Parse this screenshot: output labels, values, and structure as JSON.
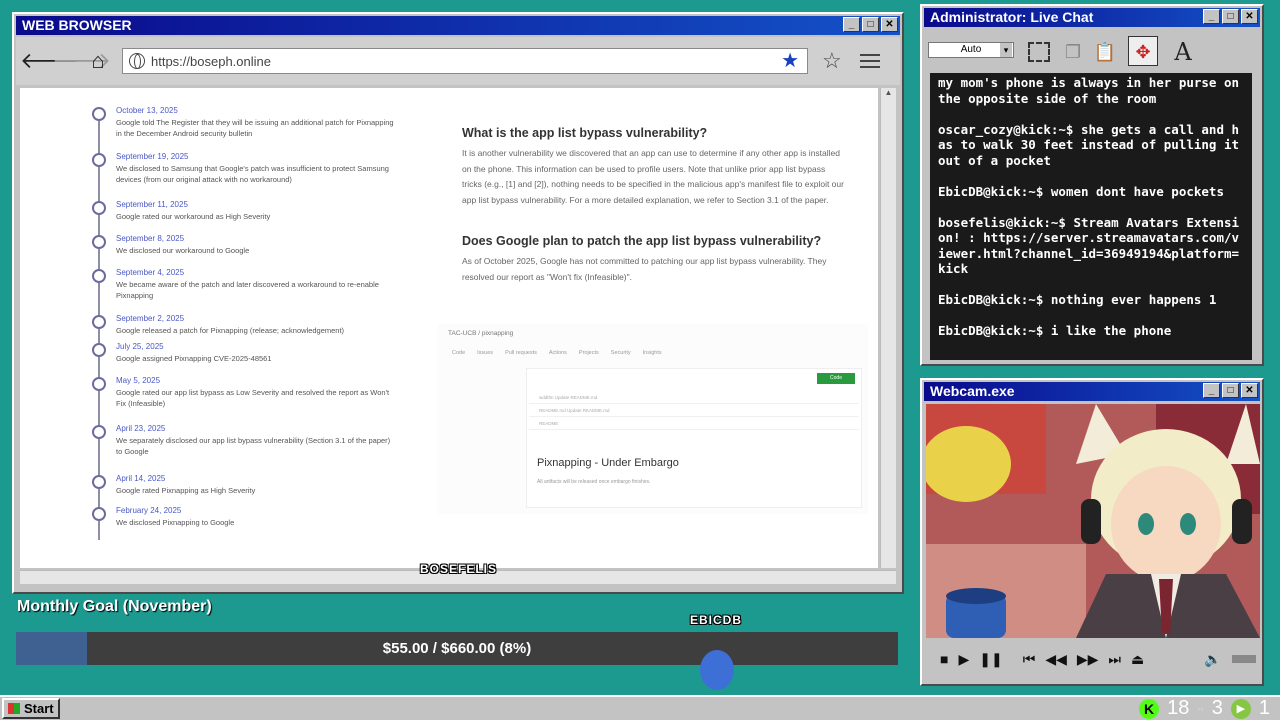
{
  "browser": {
    "title": "WEB BROWSER",
    "url": "https://boseph.online",
    "timeline": [
      {
        "date": "October 13, 2025",
        "desc": "Google told The Register that they will be issuing an additional patch for Pixnapping in the December Android security bulletin"
      },
      {
        "date": "September 19, 2025",
        "desc": "We disclosed to Samsung that Google's patch was insufficient to protect Samsung devices (from our original attack with no workaround)"
      },
      {
        "date": "September 11, 2025",
        "desc": "Google rated our workaround as High Severity"
      },
      {
        "date": "September 8, 2025",
        "desc": "We disclosed our workaround to Google"
      },
      {
        "date": "September 4, 2025",
        "desc": "We became aware of the patch and later discovered a workaround to re-enable Pixnapping"
      },
      {
        "date": "September 2, 2025",
        "desc": "Google released a patch for Pixnapping (release; acknowledgement)"
      },
      {
        "date": "July 25, 2025",
        "desc": "Google assigned Pixnapping CVE-2025-48561"
      },
      {
        "date": "May 5, 2025",
        "desc": "Google rated our app list bypass as Low Severity and resolved the report as Won't Fix (Infeasible)"
      },
      {
        "date": "April 23, 2025",
        "desc": "We separately disclosed our app list bypass vulnerability (Section 3.1 of the paper) to Google"
      },
      {
        "date": "April 14, 2025",
        "desc": "Google rated Pixnapping as High Severity"
      },
      {
        "date": "February 24, 2025",
        "desc": "We disclosed Pixnapping to Google"
      }
    ],
    "q1": "What is the app list bypass vulnerability?",
    "p1": "It is another vulnerability we discovered that an app can use to determine if any other app is installed on the phone. This information can be used to profile users. Note that unlike prior app list bypass tricks (e.g., [1] and [2]), nothing needs to be specified in the malicious app's manifest file to exploit our app list bypass vulnerability. For a more detailed explanation, we refer to Section 3.1 of the paper.",
    "q2": "Does Google plan to patch the app list bypass vulnerability?",
    "p2": "As of October 2025, Google has not committed to patching our app list bypass vulnerability. They resolved our report as \"Won't fix (Infeasible)\".",
    "github": {
      "crumb": "TAC-UCB / pixnapping",
      "tabs": [
        "Code",
        "Issues",
        "Pull requests",
        "Actions",
        "Projects",
        "Security",
        "Insights"
      ],
      "code_btn": "Code",
      "rows": [
        "wddtfm  Update README.md",
        "README.md  Update README.md",
        "README"
      ],
      "repo_title": "Pixnapping - Under Embargo",
      "repo_sub": "All artifacts will be released once embargo finishes."
    }
  },
  "chat": {
    "title": "Administrator: Live Chat",
    "select": "Auto",
    "tool_text_icon": "A",
    "messages": [
      {
        "user": "",
        "text": "my mom's phone is always in her purse on the opposite side of the room"
      },
      {
        "user": "oscar_cozy@kick:~$",
        "text": "she gets a call and has to walk 30 feet instead of pulling it out of a pocket"
      },
      {
        "user": "EbicDB@kick:~$",
        "text": "women dont have pockets"
      },
      {
        "user": "bosefelis@kick:~$",
        "text": "Stream Avatars Extension! : https://server.streamavatars.com/viewer.html?channel_id=36949194&platform=kick"
      },
      {
        "user": "EbicDB@kick:~$",
        "text": "nothing ever happens 1"
      },
      {
        "user": "EbicDB@kick:~$",
        "text": "i like the phone"
      }
    ]
  },
  "cam": {
    "title": "Webcam.exe"
  },
  "goal": {
    "title": "Monthly Goal (November)",
    "text": "$55.00 / $660.00 (8%)",
    "fraction": 0.08
  },
  "avatars": {
    "a1": "BOSEFELIS",
    "a2": "EBICDB"
  },
  "taskbar": {
    "start": "Start",
    "count1": "18",
    "count2": "3",
    "count3": "1"
  }
}
